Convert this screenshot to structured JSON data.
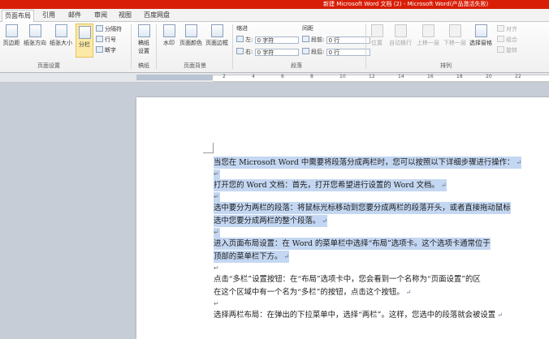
{
  "window": {
    "title": "新建 Microsoft Word 文档 (2) - Microsoft Word(产品激活失败)"
  },
  "tabs": [
    {
      "label": "页面布局",
      "active": true
    },
    {
      "label": "引用"
    },
    {
      "label": "邮件"
    },
    {
      "label": "审阅"
    },
    {
      "label": "视图"
    },
    {
      "label": "百度网盘"
    }
  ],
  "ribbon": {
    "page_setup": {
      "label": "页面设置",
      "margins": "页边距",
      "orientation": "纸张方向",
      "size": "纸张大小",
      "columns": "分栏",
      "breaks": "分隔符",
      "line_numbers": "行号",
      "hyphenation": "断字"
    },
    "manuscript": {
      "label": "稿纸",
      "settings_line1": "稿纸",
      "settings_line2": "设置"
    },
    "page_background": {
      "label": "页面背景",
      "watermark": "水印",
      "page_color": "页面颜色",
      "page_borders": "页面边框"
    },
    "paragraph": {
      "label": "段落",
      "indent_header": "缩进",
      "spacing_header": "间距",
      "indent_left_label": "左:",
      "indent_left_value": "0 字符",
      "indent_right_label": "右:",
      "indent_right_value": "0 字符",
      "spacing_before_label": "段前:",
      "spacing_before_value": "0 行",
      "spacing_after_label": "段后:",
      "spacing_after_value": "0 行"
    },
    "arrange": {
      "label": "排列",
      "position": "位置",
      "wrap_text": "自动换行",
      "bring_forward": "上移一层",
      "send_backward": "下移一层",
      "selection_pane": "选择窗格",
      "align": "对齐",
      "group": "组合",
      "rotate": "旋转"
    }
  },
  "ruler": {
    "numbers": [
      "2",
      "4",
      "6",
      "8",
      "10",
      "12",
      "14",
      "16",
      "18",
      "20",
      "22"
    ]
  },
  "document": {
    "lines": [
      {
        "text": "当您在 Microsoft Word 中需要将段落分成两栏时，您可以按照以下详细步骤进行操作：",
        "selected": true
      },
      {
        "text": "",
        "selected": true,
        "mark_only": true
      },
      {
        "text": "打开您的 Word 文档：首先，打开您希望进行设置的 Word 文档。",
        "selected": true
      },
      {
        "text": "",
        "selected": true,
        "mark_only": true
      },
      {
        "text": "选中要分为两栏的段落：将鼠标光标移动到您要分成两栏的段落开头，或者直接拖动鼠标",
        "selected": true
      },
      {
        "text": "选中您要分成两栏的整个段落。",
        "selected": true
      },
      {
        "text": "",
        "selected": true,
        "mark_only": true
      },
      {
        "text": "进入页面布局设置：在 Word 的菜单栏中选择“布局”选项卡。这个选项卡通常位于",
        "selected": true
      },
      {
        "text": "顶部的菜单栏下方。",
        "selected": true
      },
      {
        "text": "",
        "selected": false,
        "mark_only": true
      },
      {
        "text": "点击“多栏”设置按钮：在“布局”选项卡中，您会看到一个名称为“页面设置”的区",
        "selected": false
      },
      {
        "text": "在这个区域中有一个名为“多栏”的按钮，点击这个按钮。",
        "selected": false
      },
      {
        "text": "",
        "selected": false,
        "mark_only": true
      },
      {
        "text": "选择两栏布局：在弹出的下拉菜单中，选择“两栏”。这样，您选中的段落就会被设置",
        "selected": false
      }
    ],
    "paragraph_mark": "↵"
  }
}
